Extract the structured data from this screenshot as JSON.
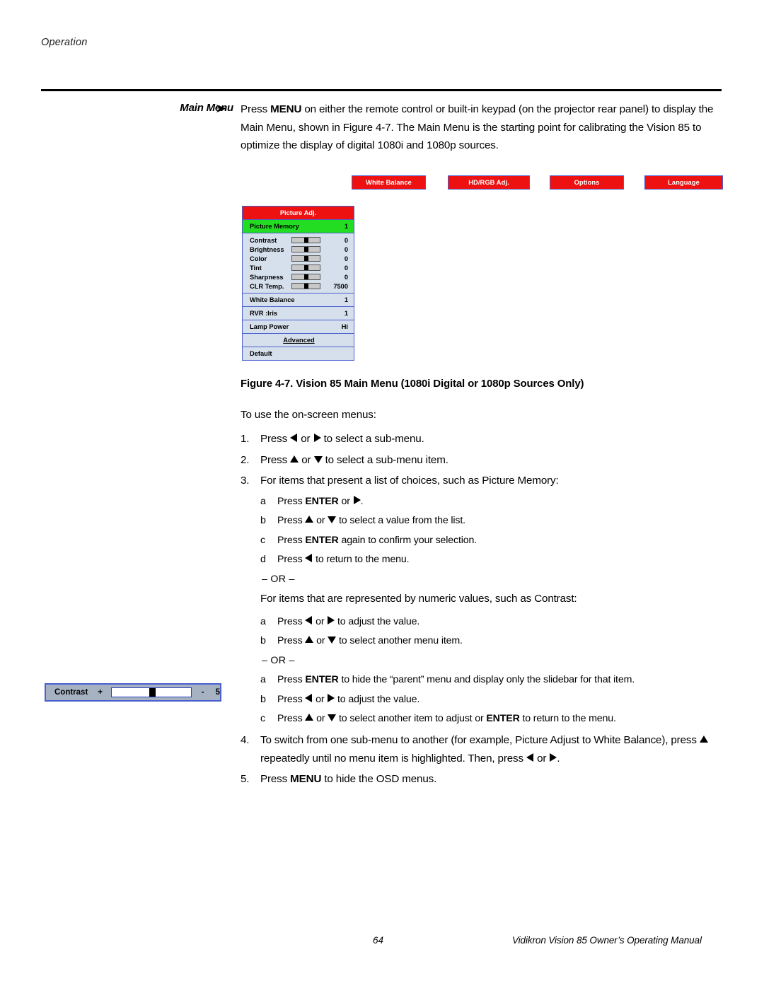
{
  "page": {
    "running_head": "Operation",
    "footer_page_number": "64",
    "footer_title": "Vidikron Vision 85 Owner’s Operating Manual"
  },
  "margin": {
    "label": "Main Menu",
    "arrow_icon": "➤"
  },
  "intro": {
    "line1_a": "Press ",
    "line1_b": "MENU",
    "line1_c": " on either the remote control or built-in keypad (on the projector rear panel) to display the Main Menu, shown in Figure 4-7. The Main Menu is the starting point for calibrating the Vision 85 to optimize the display of digital 1080i and 1080p sources."
  },
  "osd": {
    "tabs": [
      {
        "label": "White Balance"
      },
      {
        "label": "HD/RGB Adj."
      },
      {
        "label": "Options"
      },
      {
        "label": "Language"
      }
    ],
    "panel": {
      "title": "Picture Adj.",
      "memory": {
        "label": "Picture Memory",
        "value": "1"
      },
      "sliders": [
        {
          "label": "Contrast",
          "value": "0",
          "thumb_pct": 44
        },
        {
          "label": "Brightness",
          "value": "0",
          "thumb_pct": 44
        },
        {
          "label": "Color",
          "value": "0",
          "thumb_pct": 44
        },
        {
          "label": "Tint",
          "value": "0",
          "thumb_pct": 44
        },
        {
          "label": "Sharpness",
          "value": "0",
          "thumb_pct": 44
        },
        {
          "label": "CLR Temp.",
          "value": "7500",
          "thumb_pct": 44
        }
      ],
      "items": [
        {
          "label": "White Balance",
          "value": "1"
        },
        {
          "label": "RVR :Iris",
          "value": "1"
        },
        {
          "label": "Lamp Power",
          "value": "Hi"
        }
      ],
      "advanced": "Advanced",
      "default": "Default"
    },
    "colors": {
      "title_red": "#ee1111",
      "memory_green": "#22dd22",
      "border_blue": "#4a5fd0",
      "row_bg": "#d6e0ec"
    }
  },
  "figure": {
    "caption": "Figure 4-7. Vision 85 Main Menu (1080i Digital or 1080p Sources Only)"
  },
  "body": {
    "lead": "To use the on-screen menus:",
    "steps": [
      {
        "num": "1.",
        "text_before": "Press ",
        "icon1": "left-arrow",
        "mid": " or ",
        "icon2": "right-arrow",
        "text_after": " to select a sub-menu."
      },
      {
        "num": "2.",
        "text_before": "Press ",
        "icon1": "up-arrow",
        "mid": " or ",
        "icon2": "down-arrow",
        "text_after": " to select a sub-menu item."
      },
      {
        "num": "3.",
        "text_before": "For items that present a list of choices, such as Picture Memory:",
        "icon1": "",
        "mid": "",
        "icon2": "",
        "text_after": ""
      }
    ],
    "substeps_list": [
      {
        "ltr": "a",
        "pre": "Press ",
        "bold": "ENTER",
        "mid": " or ",
        "icon": "right-arrow",
        "post": "."
      },
      {
        "ltr": "b",
        "pre": "Press ",
        "bold": "",
        "mid": "",
        "icon": "",
        "post": ""
      },
      {
        "ltr": "c",
        "pre": "Press ",
        "bold": "ENTER",
        "mid": " again to confirm your selection.",
        "icon": "",
        "post": ""
      },
      {
        "ltr": "d",
        "pre": "Press ",
        "bold": "",
        "mid": "",
        "icon": "left-arrow",
        "post": " to return to the menu."
      }
    ],
    "substep_b_text": " to select a value from the list.",
    "or_divider": "– OR –",
    "numeric_para": "For items that are represented by numeric values, such as Contrast:",
    "numeric_a": " to adjust the value.",
    "numeric_b": " to select another menu item.",
    "enter_a_pre": "Press ",
    "enter_a_bold": "ENTER",
    "enter_a_post": " to hide the “parent” menu and display only the slidebar for that item.",
    "enter_b": " to adjust the value.",
    "enter_c_mid": " to select another item to adjust or ",
    "enter_c_bold": "ENTER",
    "enter_c_post": " to return to the menu.",
    "step4_line1": "To switch from one sub-menu to another (for example, Picture Adjust to White Balance),",
    "step4_line2_a": "press ",
    "step4_line2_b": " repeatedly until no menu item is highlighted. Then, press ",
    "step4_line2_c": " or ",
    "step4_line2_d": ".",
    "step4_num": "4.",
    "step5_num": "5.",
    "step5_pre": "Press ",
    "step5_bold": "MENU",
    "step5_post": " to hide the OSD menus."
  },
  "slidebar": {
    "label": "Contrast",
    "plus": "+",
    "minus": "-",
    "value": "5",
    "thumb_pct": 47
  }
}
